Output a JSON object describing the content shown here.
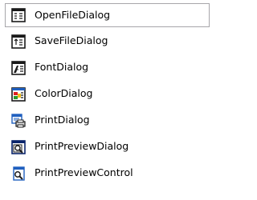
{
  "toolbox": {
    "items": [
      {
        "label": "OpenFileDialog",
        "icon": "open-file-dialog-icon",
        "selected": true
      },
      {
        "label": "SaveFileDialog",
        "icon": "save-file-dialog-icon",
        "selected": false
      },
      {
        "label": "FontDialog",
        "icon": "font-dialog-icon",
        "selected": false
      },
      {
        "label": "ColorDialog",
        "icon": "color-dialog-icon",
        "selected": false
      },
      {
        "label": "PrintDialog",
        "icon": "print-dialog-icon",
        "selected": false
      },
      {
        "label": "PrintPreviewDialog",
        "icon": "print-preview-dialog-icon",
        "selected": false
      },
      {
        "label": "PrintPreviewControl",
        "icon": "print-preview-control-icon",
        "selected": false
      }
    ]
  },
  "colors": {
    "background": "#ffffff",
    "selection_border": "#a7a6aa",
    "icon_dark": "#1a1a1a",
    "icon_blue": "#1f5fbf",
    "icon_navy": "#0a246a"
  }
}
